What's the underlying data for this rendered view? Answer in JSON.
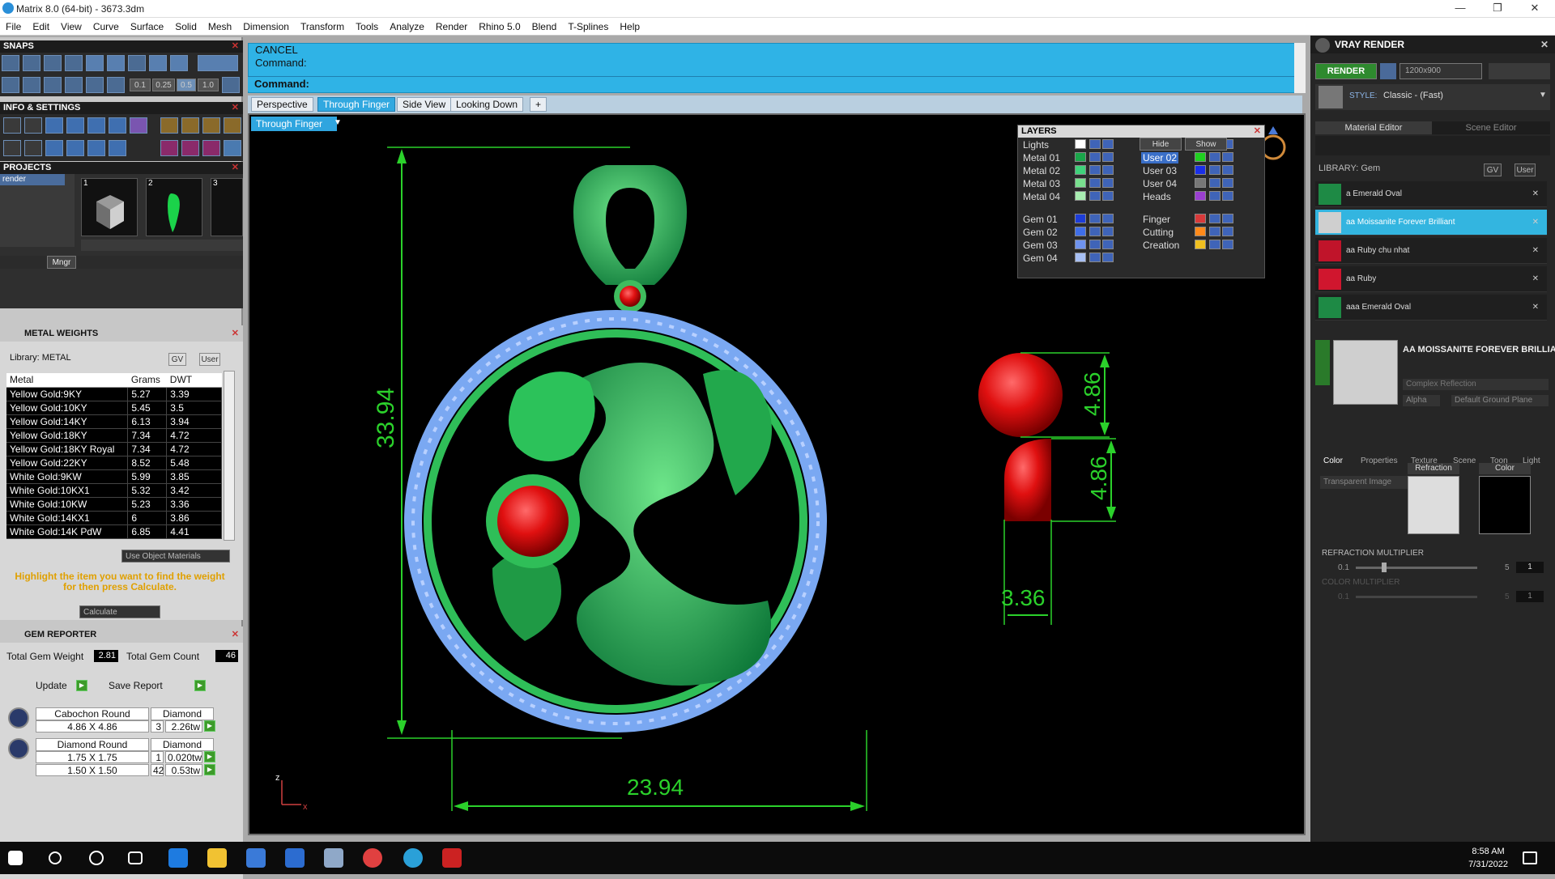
{
  "window": {
    "title": "Matrix 8.0 (64-bit) - 3673.3dm",
    "controls": [
      "—",
      "❐",
      "✕"
    ]
  },
  "menu": [
    "File",
    "Edit",
    "View",
    "Curve",
    "Surface",
    "Solid",
    "Mesh",
    "Dimension",
    "Transform",
    "Tools",
    "Analyze",
    "Render",
    "Rhino 5.0",
    "Blend",
    "T-Splines",
    "Help"
  ],
  "left": {
    "snaps_title": "SNAPS",
    "snap_values": [
      "0.1",
      "0.25",
      "0.5",
      "1.0"
    ],
    "info_title": "INFO & SETTINGS",
    "projects_title": "PROJECTS",
    "projects_selected": "render",
    "project_numbers": [
      "1",
      "2",
      "3"
    ],
    "mngr": "Mngr",
    "metal_title": "METAL WEIGHTS",
    "library": "Library: METAL",
    "lib_gv": "GV",
    "lib_user": "User",
    "metal_cols": [
      "Metal",
      "Grams",
      "DWT"
    ],
    "metals": [
      [
        "Yellow Gold:9KY",
        "5.27",
        "3.39"
      ],
      [
        "Yellow Gold:10KY",
        "5.45",
        "3.5"
      ],
      [
        "Yellow Gold:14KY",
        "6.13",
        "3.94"
      ],
      [
        "Yellow Gold:18KY",
        "7.34",
        "4.72"
      ],
      [
        "Yellow Gold:18KY Royal",
        "7.34",
        "4.72"
      ],
      [
        "Yellow Gold:22KY",
        "8.52",
        "5.48"
      ],
      [
        "White Gold:9KW",
        "5.99",
        "3.85"
      ],
      [
        "White Gold:10KX1",
        "5.32",
        "3.42"
      ],
      [
        "White Gold:10KW",
        "5.23",
        "3.36"
      ],
      [
        "White Gold:14KX1",
        "6",
        "3.86"
      ],
      [
        "White Gold:14K PdW",
        "6.85",
        "4.41"
      ]
    ],
    "use_object_materials": "Use Object Materials",
    "hint": "Highlight the item you want to find the weight for then press Calculate.",
    "calculate": "Calculate",
    "gem_title": "GEM REPORTER",
    "total_gem_weight_label": "Total Gem Weight",
    "total_gem_weight": "2.81",
    "total_gem_count_label": "Total Gem Count",
    "total_gem_count": "46",
    "update": "Update",
    "save_report": "Save Report",
    "gems": [
      {
        "name": "Cabochon Round",
        "type": "Diamond",
        "rows": [
          [
            "4.86 X 4.86",
            "3",
            "2.26tw"
          ]
        ]
      },
      {
        "name": "Diamond Round",
        "type": "Diamond",
        "rows": [
          [
            "1.75 X 1.75",
            "1",
            "0.020tw"
          ],
          [
            "1.50 X 1.50",
            "42",
            "0.53tw"
          ]
        ]
      }
    ]
  },
  "command": {
    "line1": "CANCEL",
    "line2": "Command:",
    "prompt": "Command:"
  },
  "viewport_tabs": [
    "Perspective",
    "Through Finger",
    "Side View",
    "Looking Down",
    "+"
  ],
  "active_view": "Through Finger",
  "layers": {
    "title": "LAYERS",
    "hide": "Hide",
    "show": "Show",
    "left": [
      {
        "name": "Lights",
        "color": "#ffffff"
      },
      {
        "name": "Metal 01",
        "color": "#1aa64a"
      },
      {
        "name": "Metal 02",
        "color": "#3fd27a"
      },
      {
        "name": "Metal 03",
        "color": "#79e08f"
      },
      {
        "name": "Metal 04",
        "color": "#a8ecb0"
      },
      {
        "name": "Gem 01",
        "color": "#1d3dd8"
      },
      {
        "name": "Gem 02",
        "color": "#3f6ee8"
      },
      {
        "name": "Gem 03",
        "color": "#6f93ee"
      },
      {
        "name": "Gem 04",
        "color": "#a8c0f4"
      }
    ],
    "right": [
      {
        "name": "User 01",
        "color": "#e02020"
      },
      {
        "name": "User 02",
        "color": "#20d020"
      },
      {
        "name": "User 03",
        "color": "#1a2fe8"
      },
      {
        "name": "User 04",
        "color": "#777777"
      },
      {
        "name": "Heads",
        "color": "#9a3fd0"
      },
      {
        "name": "Finger",
        "color": "#d83a3a"
      },
      {
        "name": "Cutting",
        "color": "#ff8a1a"
      },
      {
        "name": "Creation",
        "color": "#f0c020"
      }
    ],
    "selected": "User 02"
  },
  "dimensions": {
    "height": "33.94",
    "width": "23.94",
    "gem_dia": "4.86",
    "gem_side": "4.86",
    "gem_depth": "3.36"
  },
  "axis": {
    "z": "z",
    "x": "x"
  },
  "vray": {
    "title": "VRAY RENDER",
    "render": "RENDER",
    "resolution": "1200x900",
    "style_label": "STYLE:",
    "style": "Classic - (Fast)",
    "tabs": [
      "Material Editor",
      "Scene Editor"
    ],
    "library": "LIBRARY: Gem",
    "lib_gv": "GV",
    "lib_user": "User",
    "materials": [
      {
        "name": "a Emerald Oval",
        "color": "#1e8a45",
        "sel": false
      },
      {
        "name": "aa Moissanite Forever Brilliant",
        "color": "#cfcfcf",
        "sel": true
      },
      {
        "name": "aa Ruby chu nhat",
        "color": "#c0142a",
        "sel": false
      },
      {
        "name": "aa Ruby",
        "color": "#d0162e",
        "sel": false
      },
      {
        "name": "aaa Emerald Oval",
        "color": "#1e8a45",
        "sel": false
      }
    ],
    "selected_material": "AA MOISSANITE FOREVER BRILLIANT",
    "reflection": "Complex Reflection",
    "alpha": "Alpha",
    "ground": "Default Ground Plane",
    "prop_tabs": [
      "Color",
      "Properties",
      "Texture",
      "Scene",
      "Toon",
      "Light"
    ],
    "transparent": "Transparent Image",
    "refraction": "Refraction",
    "color": "Color",
    "refraction_multiplier": "REFRACTION MULTIPLIER",
    "color_multiplier": "COLOR MULTIPLIER",
    "rm_min": "0.1",
    "rm_max": "5",
    "rm_value": "1",
    "cm_min": "0.1",
    "cm_max": "5",
    "cm_value": "1"
  },
  "taskbar": {
    "time": "8:58 AM",
    "date": "7/31/2022"
  }
}
